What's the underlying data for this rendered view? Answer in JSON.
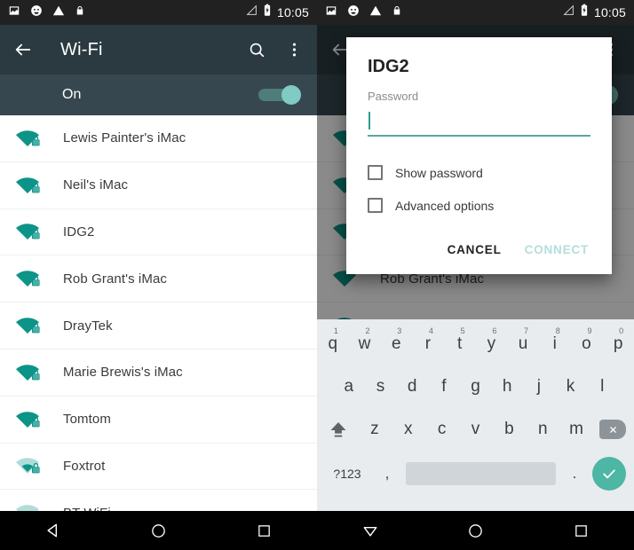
{
  "status_bar": {
    "time": "10:05",
    "icons_left": [
      "image-icon",
      "face-icon",
      "warning-icon",
      "lock-icon"
    ],
    "icons_right": [
      "signal-icon",
      "battery-charging-icon"
    ]
  },
  "toolbar": {
    "title": "Wi-Fi",
    "back_icon": "back-arrow-icon",
    "search_icon": "search-icon",
    "overflow_icon": "overflow-menu-icon"
  },
  "wifi_switch": {
    "label": "On",
    "state": "on"
  },
  "networks": [
    {
      "name": "Lewis Painter's iMac",
      "secured": true,
      "strength": "full"
    },
    {
      "name": "Neil's iMac",
      "secured": true,
      "strength": "full"
    },
    {
      "name": "IDG2",
      "secured": true,
      "strength": "full"
    },
    {
      "name": "Rob Grant's iMac",
      "secured": true,
      "strength": "full"
    },
    {
      "name": "DrayTek",
      "secured": true,
      "strength": "full"
    },
    {
      "name": "Marie Brewis's iMac",
      "secured": true,
      "strength": "full"
    },
    {
      "name": "Tomtom",
      "secured": true,
      "strength": "full"
    },
    {
      "name": "Foxtrot",
      "secured": true,
      "strength": "weak"
    },
    {
      "name": "BT WiFi",
      "secured": true,
      "strength": "weak"
    }
  ],
  "dialog": {
    "title": "IDG2",
    "password_label": "Password",
    "password_value": "",
    "show_password": {
      "label": "Show password",
      "checked": false
    },
    "advanced_options": {
      "label": "Advanced options",
      "checked": false
    },
    "cancel_label": "CANCEL",
    "connect_label": "CONNECT",
    "connect_enabled": false
  },
  "keyboard": {
    "row1": [
      {
        "key": "q",
        "sup": "1"
      },
      {
        "key": "w",
        "sup": "2"
      },
      {
        "key": "e",
        "sup": "3"
      },
      {
        "key": "r",
        "sup": "4"
      },
      {
        "key": "t",
        "sup": "5"
      },
      {
        "key": "y",
        "sup": "6"
      },
      {
        "key": "u",
        "sup": "7"
      },
      {
        "key": "i",
        "sup": "8"
      },
      {
        "key": "o",
        "sup": "9"
      },
      {
        "key": "p",
        "sup": "0"
      }
    ],
    "row2": [
      "a",
      "s",
      "d",
      "f",
      "g",
      "h",
      "j",
      "k",
      "l"
    ],
    "row3": [
      "z",
      "x",
      "c",
      "v",
      "b",
      "n",
      "m"
    ],
    "shift_icon": "shift-icon",
    "backspace_icon": "backspace-icon",
    "numeric_label": "?123",
    "comma": ",",
    "period": ".",
    "space_label": "",
    "enter_icon": "check-icon"
  },
  "nav_bar_left": {
    "back_icon": "nav-back-icon",
    "home_icon": "nav-home-icon",
    "recents_icon": "nav-recents-icon"
  },
  "nav_bar_right": {
    "back_icon": "nav-keyboard-dismiss-icon",
    "home_icon": "nav-home-icon",
    "recents_icon": "nav-recents-icon"
  },
  "colors": {
    "toolbar_bg": "#2b3a40",
    "status_bg": "#212121",
    "switch_row_bg": "#37474f",
    "accent_teal": "#009688",
    "wifi_icon": "#0d9488",
    "toggle_thumb": "#80cbc4",
    "connect_disabled": "#b2dfdb",
    "keyboard_bg": "#e8ecee"
  }
}
